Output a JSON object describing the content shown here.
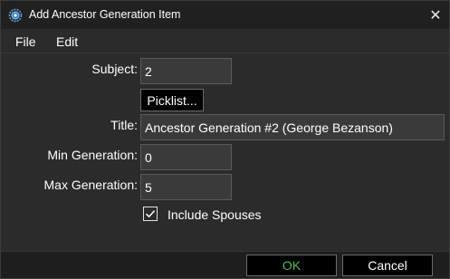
{
  "window": {
    "title": "Add Ancestor Generation Item",
    "close_glyph": "✕",
    "app_icon": "gear-globe-icon"
  },
  "menu": {
    "items": [
      {
        "label": "File"
      },
      {
        "label": "Edit"
      }
    ]
  },
  "form": {
    "subject_label": "Subject:",
    "subject_value": "2",
    "picklist_label": "Picklist...",
    "title_label": "Title:",
    "title_value": "Ancestor Generation #2 (George Bezanson)",
    "min_generation_label": "Min Generation:",
    "min_generation_value": "0",
    "max_generation_label": "Max Generation:",
    "max_generation_value": "5",
    "include_spouses_label": "Include Spouses",
    "include_spouses_checked": true
  },
  "footer": {
    "ok_label": "OK",
    "cancel_label": "Cancel"
  },
  "colors": {
    "ok_text": "#4cba4c",
    "background": "#2b2b2b",
    "titlebar": "#202020"
  }
}
